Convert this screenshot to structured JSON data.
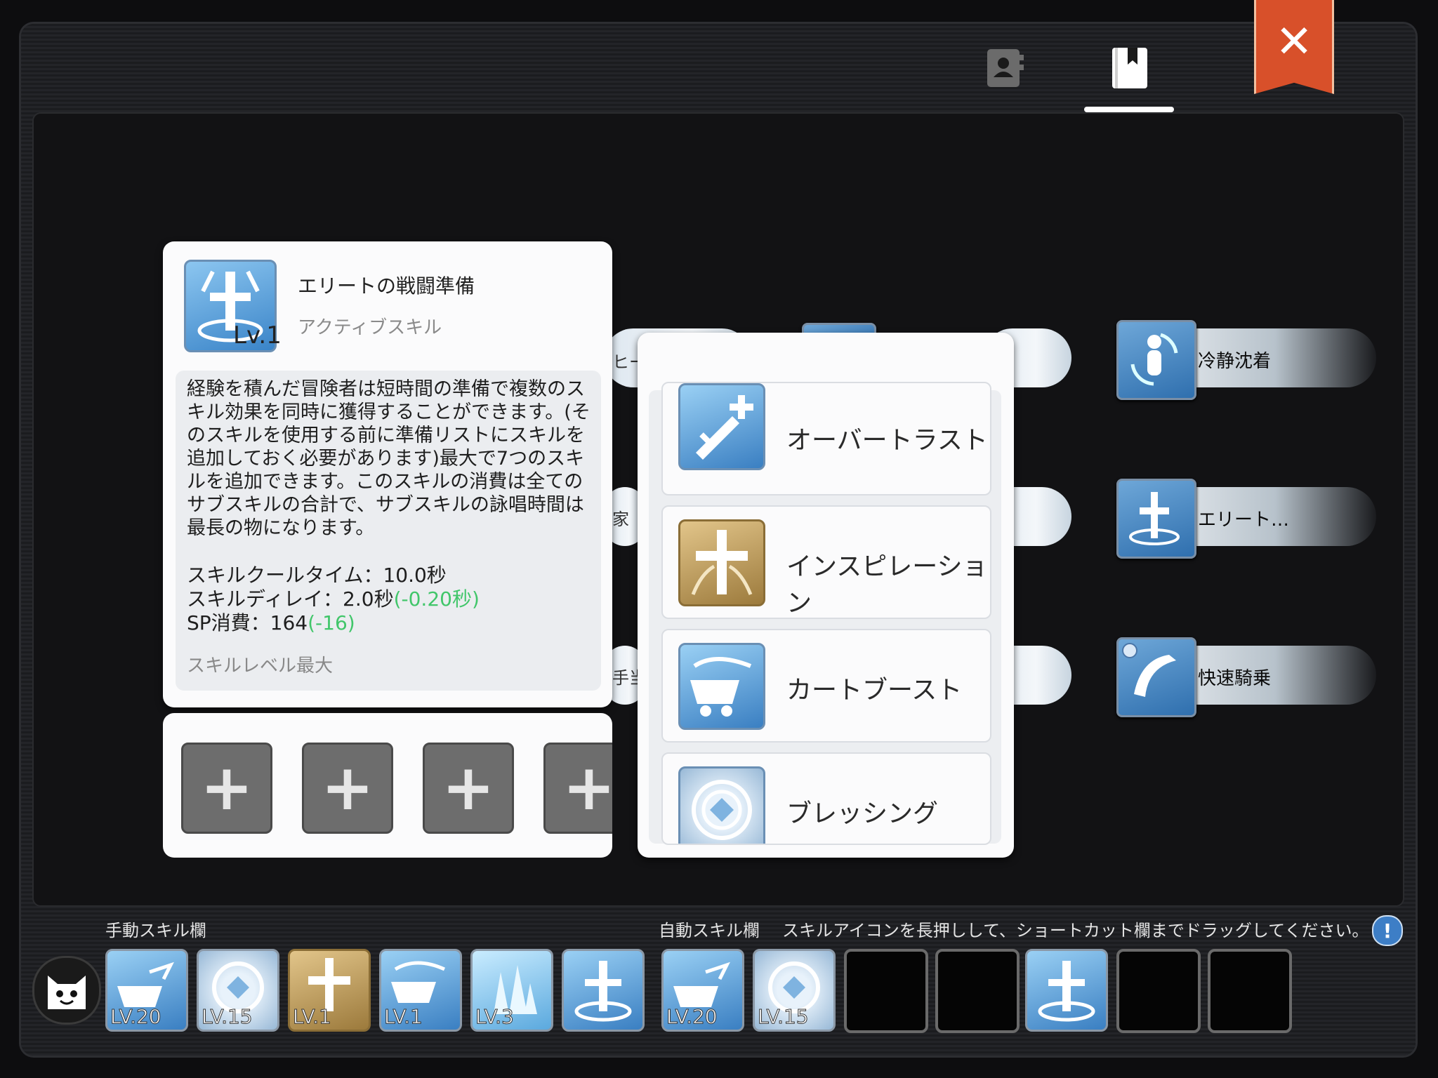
{
  "detail": {
    "title": "エリートの戦闘準備",
    "type": "アクティブスキル",
    "level": "Lv.1",
    "description": "経験を積んだ冒険者は短時間の準備で複数のスキル効果を同時に獲得することができます。(そのスキルを使用する前に準備リストにスキルを追加しておく必要があります)最大で7つのスキルを追加できます。このスキルの消費は全てのサブスキルの合計で、サブスキルの詠唱時間は最長の物になります。",
    "cooltime": "スキルクールタイム：10.0秒",
    "delay": "スキルディレイ：2.0秒",
    "delay_bonus": "(-0.20秒)",
    "sp": "SP消費：164",
    "sp_bonus": "(-16)",
    "max_level": "スキルレベル最大"
  },
  "slots": [
    "+",
    "+",
    "+",
    "+"
  ],
  "skill_list": [
    {
      "label": "オーバートラスト",
      "icon": "sword-plus-icon"
    },
    {
      "label": "インスピレーション",
      "icon": "golden-cross-icon"
    },
    {
      "label": "カートブースト",
      "icon": "cart-icon"
    },
    {
      "label": "ブレッシング",
      "icon": "blessing-icon"
    }
  ],
  "tree": {
    "right_skills": [
      "冷静沈着",
      "エリート…",
      "快速騎乗"
    ],
    "hidden_fragments": [
      "ヒー",
      "家",
      "手当"
    ]
  },
  "bottom": {
    "manual_label": "手動スキル欄",
    "auto_label": "自動スキル欄",
    "hint": "スキルアイコンを長押しして、ショートカット欄までドラッグしてください。",
    "info": "!",
    "manual": [
      {
        "icon": "cart-boost-icon",
        "level": "LV.20"
      },
      {
        "icon": "blessing-icon",
        "level": "LV.15"
      },
      {
        "icon": "golden-cross-icon",
        "level": "LV.1"
      },
      {
        "icon": "cart-icon",
        "level": "LV.1"
      },
      {
        "icon": "crystal-icon",
        "level": "LV.3"
      },
      {
        "icon": "elite-prep-icon",
        "level": ""
      }
    ],
    "auto": [
      {
        "icon": "cart-boost-icon",
        "level": "LV.20"
      },
      {
        "icon": "blessing-icon",
        "level": "LV.15"
      },
      {
        "icon": "",
        "level": ""
      },
      {
        "icon": "",
        "level": ""
      },
      {
        "icon": "elite-prep-icon",
        "level": ""
      },
      {
        "icon": "",
        "level": ""
      },
      {
        "icon": "",
        "level": ""
      }
    ]
  },
  "colors": {
    "close": "#d8502a",
    "accent_green": "#41c66a",
    "icon_blue": "#3a84c8"
  }
}
